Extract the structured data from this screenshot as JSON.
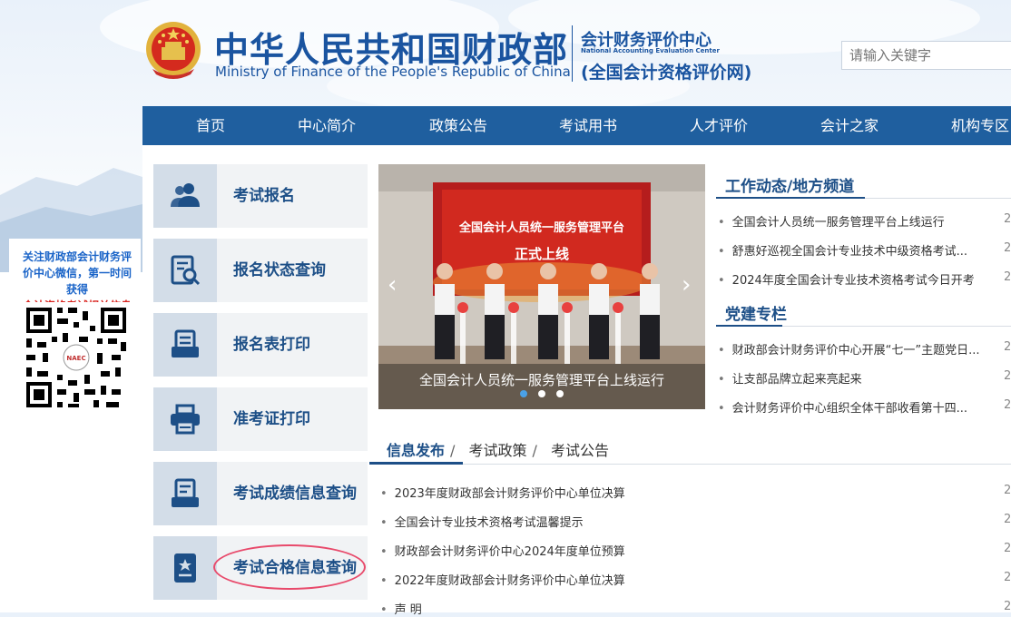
{
  "header": {
    "title_cn": "中华人民共和国财政部",
    "title_en": "Ministry of Finance of the People's Republic of China",
    "center_cn": "会计财务评价中心",
    "center_en": "National Accounting Evaluation Center",
    "site_name": "(全国会计资格评价网)",
    "search_placeholder": "请输入关键字"
  },
  "nav": {
    "items": [
      {
        "label": "首页"
      },
      {
        "label": "中心简介"
      },
      {
        "label": "政策公告"
      },
      {
        "label": "考试用书"
      },
      {
        "label": "人才评价"
      },
      {
        "label": "会计之家"
      },
      {
        "label": "机构专区"
      }
    ]
  },
  "qr_panel": {
    "line1": "关注财政部会计财务评价中心微信，",
    "line2": "第一时间获得",
    "line3": "会计资格考试相关信息",
    "logo_text": "NAEC"
  },
  "services": [
    {
      "label": "考试报名",
      "icon": "users-icon"
    },
    {
      "label": "报名状态查询",
      "icon": "document-search-icon"
    },
    {
      "label": "报名表打印",
      "icon": "form-print-icon"
    },
    {
      "label": "准考证打印",
      "icon": "printer-icon"
    },
    {
      "label": "考试成绩信息查询",
      "icon": "score-report-icon"
    },
    {
      "label": "考试合格信息查询",
      "icon": "certificate-icon"
    }
  ],
  "carousel": {
    "caption": "全国会计人员统一服务管理平台上线运行",
    "screen_title": "全国会计人员统一服务管理平台",
    "screen_subtitle": "正式上线",
    "slide_count": 3,
    "active_index": 0
  },
  "work_news": {
    "title": "工作动态/地方频道",
    "items": [
      {
        "text": "全国会计人员统一服务管理平台上线运行",
        "date": "2"
      },
      {
        "text": "舒惠好巡视全国会计专业技术中级资格考试...",
        "date": "2"
      },
      {
        "text": "2024年度全国会计专业技术资格考试今日开考",
        "date": "2"
      }
    ]
  },
  "party_news": {
    "title": "党建专栏",
    "items": [
      {
        "text": "财政部会计财务评价中心开展“七一”主题党日...",
        "date": "2"
      },
      {
        "text": "让支部品牌立起来亮起来",
        "date": "2"
      },
      {
        "text": "会计财务评价中心组织全体干部收看第十四...",
        "date": "2"
      }
    ]
  },
  "info_tabs": {
    "tabs": [
      {
        "label": "信息发布"
      },
      {
        "label": "考试政策"
      },
      {
        "label": "考试公告"
      }
    ],
    "separator": "/",
    "items": [
      {
        "text": "2023年度财政部会计财务评价中心单位决算",
        "date": "2"
      },
      {
        "text": "全国会计专业技术资格考试温馨提示",
        "date": "2"
      },
      {
        "text": "财政部会计财务评价中心2024年度单位预算",
        "date": "2"
      },
      {
        "text": "2022年度财政部会计财务评价中心单位决算",
        "date": "2"
      },
      {
        "text": "声  明",
        "date": "2"
      }
    ]
  },
  "colors": {
    "brand_blue": "#1a54a0",
    "nav_blue": "#1f5f9f",
    "highlight_circle": "#e84a6b",
    "qr_text_blue": "#1a64c8",
    "qr_text_red": "#d9241f"
  }
}
